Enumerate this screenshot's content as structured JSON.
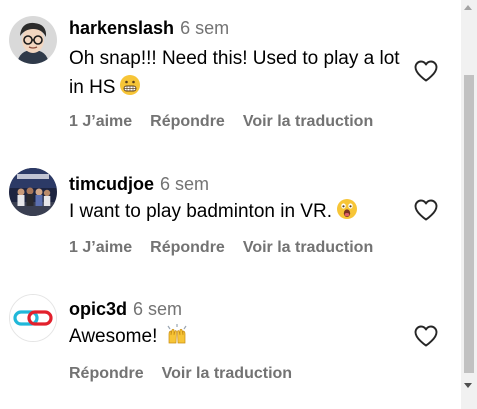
{
  "comments": [
    {
      "username": "harkenslash",
      "time": "6 sem",
      "text": "Oh snap!!! Need this! Used to play a lot in HS",
      "emoji": "grimacing-face-emoji",
      "actions": {
        "likes": "1 J’aime",
        "reply": "Répondre",
        "translate": "Voir la traduction"
      },
      "avatar": "cartoon-avatar-with-glasses",
      "liked": false
    },
    {
      "username": "timcudjoe",
      "time": "6 sem",
      "text": "I want to play badminton in VR.",
      "emoji": "astonished-face-emoji",
      "actions": {
        "likes": "1 J’aime",
        "reply": "Répondre",
        "translate": "Voir la traduction"
      },
      "avatar": "group-photo-avatar",
      "liked": false
    },
    {
      "username": "opic3d",
      "time": "6 sem",
      "text": "Awesome!",
      "emoji": "raising-hands-emoji",
      "actions": {
        "reply": "Répondre",
        "translate": "Voir la traduction"
      },
      "avatar": "linked-rings-logo",
      "liked": false
    }
  ],
  "colors": {
    "secondary_text": "#737373",
    "primary_text": "#000000",
    "scrollbar_track": "#f1f1f1",
    "scrollbar_thumb": "#c1c1c1"
  }
}
